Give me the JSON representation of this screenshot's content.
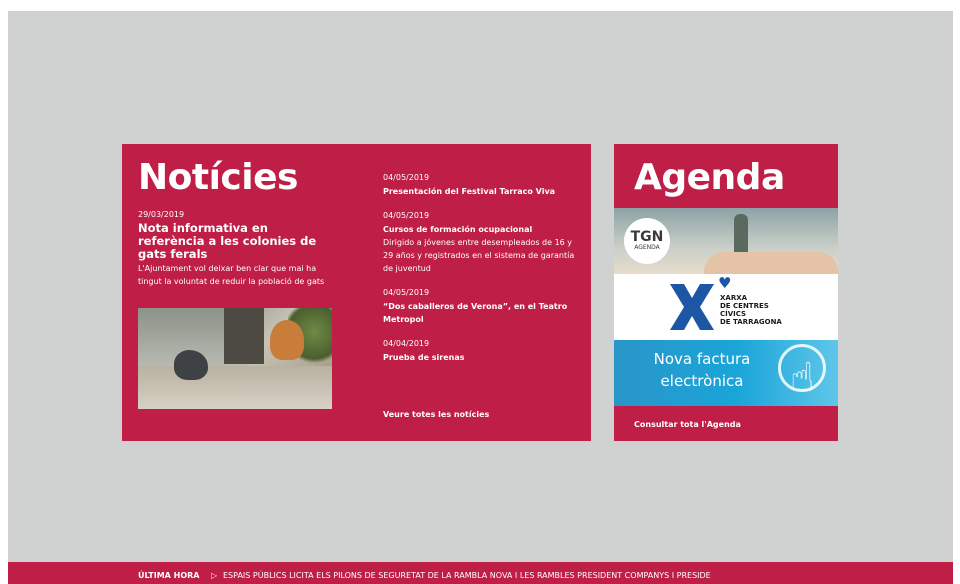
{
  "news": {
    "title": "Notícies",
    "featured": {
      "date": "29/03/2019",
      "title": "Nota informativa en referència a les colonies de gats ferals",
      "description": "L'Ajuntament vol deixar ben clar que mai ha tingut la voluntat de reduir la població de gats"
    },
    "items": [
      {
        "date": "04/05/2019",
        "title": "Presentación del Festival Tarraco Viva",
        "description": ""
      },
      {
        "date": "04/05/2019",
        "title": "Cursos de formación ocupacional",
        "description": "Dirigido a jóvenes entre desempleados de 16 y 29 años y registrados en el sistema de garantía de juventud"
      },
      {
        "date": "04/05/2019",
        "title": "“Dos caballeros de Verona”, en el Teatro Metropol",
        "description": ""
      },
      {
        "date": "04/04/2019",
        "title": "Prueba de sirenas",
        "description": ""
      }
    ],
    "see_all": "Veure totes les notícies"
  },
  "agenda": {
    "title": "Agenda",
    "banners": {
      "tgn_main": "TGN",
      "tgn_sub": "AGENDA",
      "xarxa_lines": [
        "XARXA",
        "DE CENTRES",
        "CÍVICS",
        "DE TARRAGONA"
      ],
      "factura": "Nova factura electrònica"
    },
    "see_all": "Consultar tota l'Agenda"
  },
  "ticker": {
    "label": "ÚLTIMA HORA",
    "text": "ESPAIS PÚBLICS LICITA ELS PILONS DE SEGURETAT DE LA RAMBLA NOVA I LES RAMBLES PRESIDENT COMPANYS I PRESIDE"
  },
  "colors": {
    "accent": "#bf1e47",
    "background": "#d0d2d1",
    "xarxa_blue": "#1e56a6",
    "factura_blue": "#1aa5d8"
  }
}
